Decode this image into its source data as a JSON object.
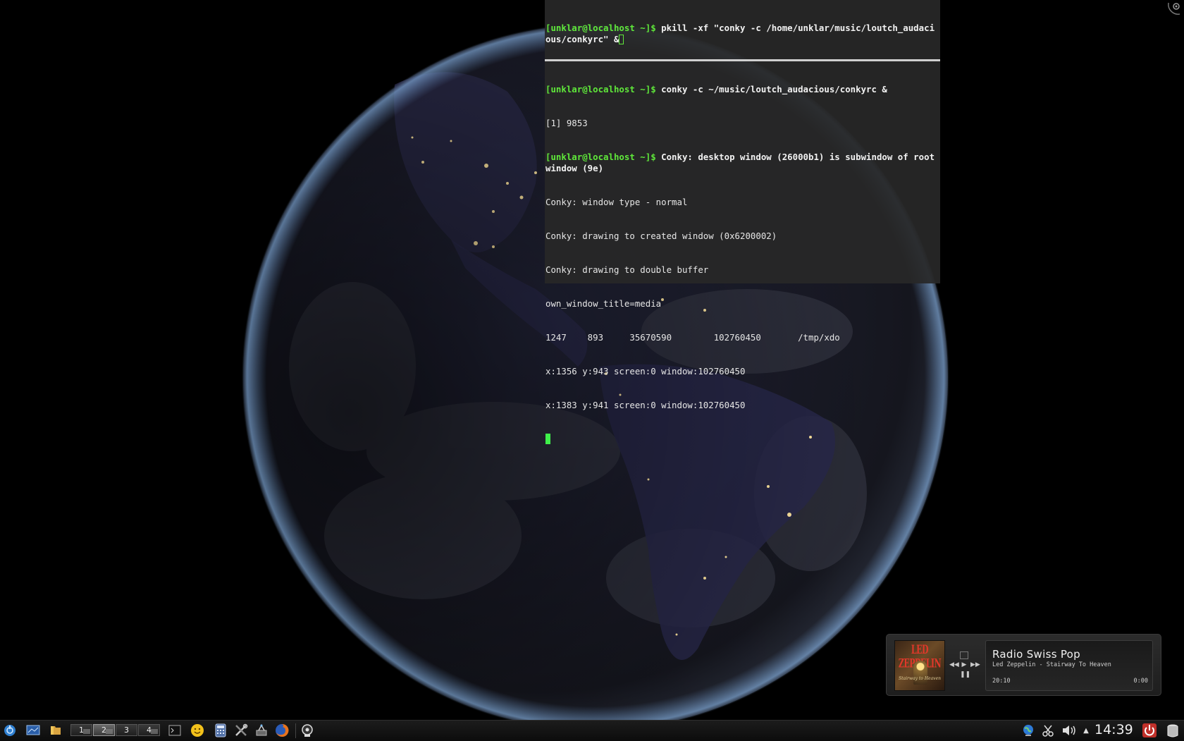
{
  "terminal_top": {
    "lines": [
      {
        "prompt": "[unklar@localhost ~]$",
        "text": " pkill -xf \"conky -c /home/unklar/music/loutch_audacious/conkyrc\" &"
      }
    ]
  },
  "terminal_bottom": {
    "prompt1": "[unklar@localhost ~]$",
    "cmd1": " conky -c ~/music/loutch_audacious/conkyrc &",
    "job": "[1] 9853",
    "prompt2": "[unklar@localhost ~]$",
    "cmd2": " Conky: desktop window (26000b1) is subwindow of root window (9e)",
    "output": [
      "Conky: window type - normal",
      "Conky: drawing to created window (0x6200002)",
      "Conky: drawing to double buffer",
      "own_window_title=media",
      "1247    893     35670590        102760450       /tmp/xdo",
      "x:1356 y:943 screen:0 window:102760450",
      "x:1383 y:941 screen:0 window:102760450"
    ]
  },
  "media_player": {
    "album_band": "LED ZEPPELIN",
    "album_subtitle": "Stairway to Heaven",
    "station": "Radio Swiss Pop",
    "track": "Led Zeppelin - Stairway To Heaven",
    "elapsed": "20:10",
    "remaining": "0:00",
    "controls": {
      "prev": "◀◀",
      "play": "▶",
      "next": "▶▶",
      "pause": "❚❚"
    }
  },
  "taskbar": {
    "desktops": [
      "1",
      "2",
      "3",
      "4"
    ],
    "active_desktop": "2",
    "launchers": [
      "kickoff-icon",
      "show-desktop-icon",
      "file-manager-icon",
      "terminal-icon",
      "smiley-icon",
      "calculator-icon",
      "system-settings-icon",
      "network-tool-icon",
      "firefox-icon",
      "media-player-icon"
    ],
    "tray": [
      "network-globe-icon",
      "klipper-scissors-icon",
      "volume-icon",
      "expand-arrow-icon"
    ],
    "clock": "14:39",
    "colors": {
      "power": "#c0302a"
    }
  }
}
